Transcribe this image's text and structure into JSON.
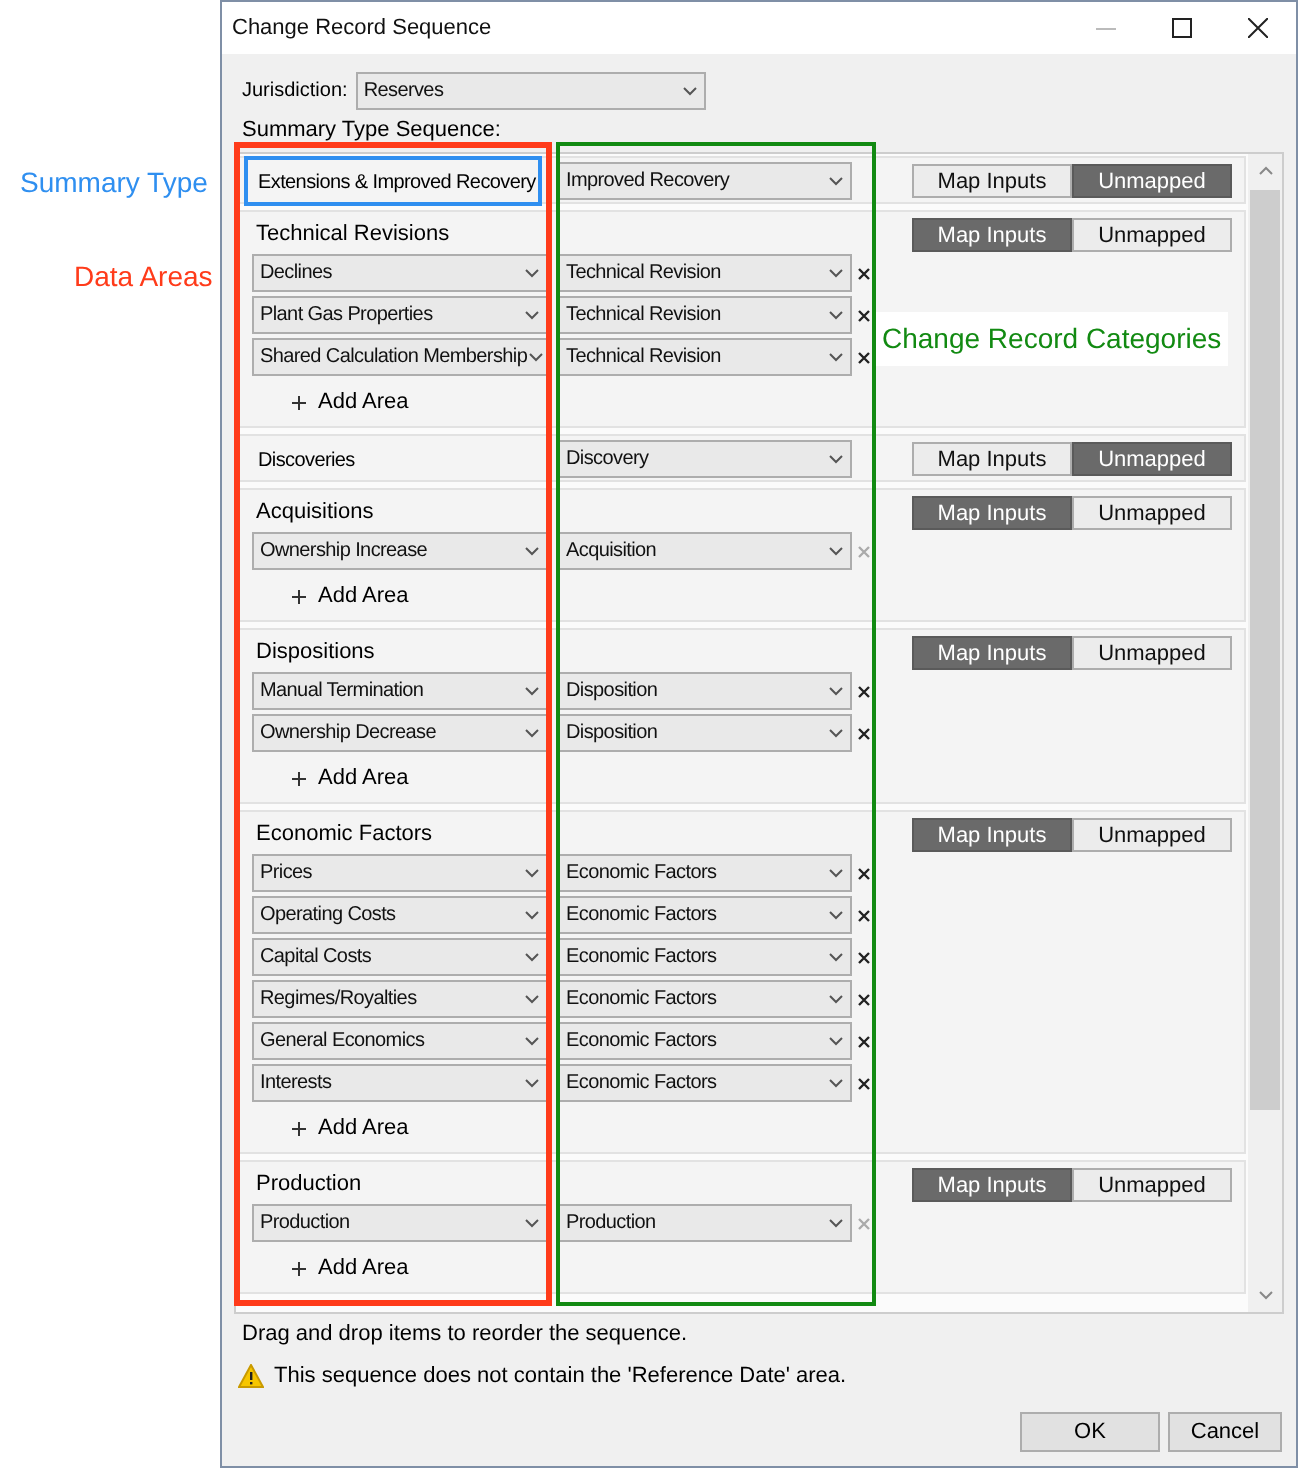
{
  "window": {
    "title": "Change Record Sequence"
  },
  "jurisdiction": {
    "label": "Jurisdiction:",
    "value": "Reserves"
  },
  "sequence_label": "Summary Type Sequence:",
  "summary_types": [
    {
      "kind": "single",
      "name": "Extensions & Improved Recovery",
      "category": "Improved Recovery",
      "toggle": [
        {
          "label": "Map Inputs",
          "selected": false
        },
        {
          "label": "Unmapped",
          "selected": true
        }
      ]
    },
    {
      "kind": "group",
      "name": "Technical Revisions",
      "toggle": [
        {
          "label": "Map Inputs",
          "selected": true
        },
        {
          "label": "Unmapped",
          "selected": false
        }
      ],
      "areas": [
        {
          "name": "Declines",
          "category": "Technical Revision",
          "removable": true
        },
        {
          "name": "Plant Gas Properties",
          "category": "Technical Revision",
          "removable": true
        },
        {
          "name": "Shared Calculation Membership",
          "category": "Technical Revision",
          "removable": true
        }
      ],
      "add_label": "Add Area"
    },
    {
      "kind": "single",
      "name": "Discoveries",
      "category": "Discovery",
      "toggle": [
        {
          "label": "Map Inputs",
          "selected": false
        },
        {
          "label": "Unmapped",
          "selected": true
        }
      ]
    },
    {
      "kind": "group",
      "name": "Acquisitions",
      "toggle": [
        {
          "label": "Map Inputs",
          "selected": true
        },
        {
          "label": "Unmapped",
          "selected": false
        }
      ],
      "areas": [
        {
          "name": "Ownership Increase",
          "category": "Acquisition",
          "removable": false
        }
      ],
      "add_label": "Add Area"
    },
    {
      "kind": "group",
      "name": "Dispositions",
      "toggle": [
        {
          "label": "Map Inputs",
          "selected": true
        },
        {
          "label": "Unmapped",
          "selected": false
        }
      ],
      "areas": [
        {
          "name": "Manual Termination",
          "category": "Disposition",
          "removable": true
        },
        {
          "name": "Ownership Decrease",
          "category": "Disposition",
          "removable": true
        }
      ],
      "add_label": "Add Area"
    },
    {
      "kind": "group",
      "name": "Economic Factors",
      "toggle": [
        {
          "label": "Map Inputs",
          "selected": true
        },
        {
          "label": "Unmapped",
          "selected": false
        }
      ],
      "areas": [
        {
          "name": "Prices",
          "category": "Economic Factors",
          "removable": true
        },
        {
          "name": "Operating Costs",
          "category": "Economic Factors",
          "removable": true
        },
        {
          "name": "Capital Costs",
          "category": "Economic Factors",
          "removable": true
        },
        {
          "name": "Regimes/Royalties",
          "category": "Economic Factors",
          "removable": true
        },
        {
          "name": "General Economics",
          "category": "Economic Factors",
          "removable": true
        },
        {
          "name": "Interests",
          "category": "Economic Factors",
          "removable": true
        }
      ],
      "add_label": "Add Area"
    },
    {
      "kind": "group",
      "name": "Production",
      "toggle": [
        {
          "label": "Map Inputs",
          "selected": true
        },
        {
          "label": "Unmapped",
          "selected": false
        }
      ],
      "areas": [
        {
          "name": "Production",
          "category": "Production",
          "removable": false
        }
      ],
      "add_label": "Add Area"
    }
  ],
  "hint": "Drag and drop items to reorder the sequence.",
  "warning": "This sequence does not contain the 'Reference Date' area.",
  "buttons": [
    "OK",
    "Cancel"
  ],
  "annotations": [
    {
      "label": "Summary Type",
      "color": "#2f8ff0"
    },
    {
      "label": "Data Areas",
      "color": "#ff3b1a"
    },
    {
      "label": "Change Record Categories",
      "color": "#128a12"
    }
  ]
}
